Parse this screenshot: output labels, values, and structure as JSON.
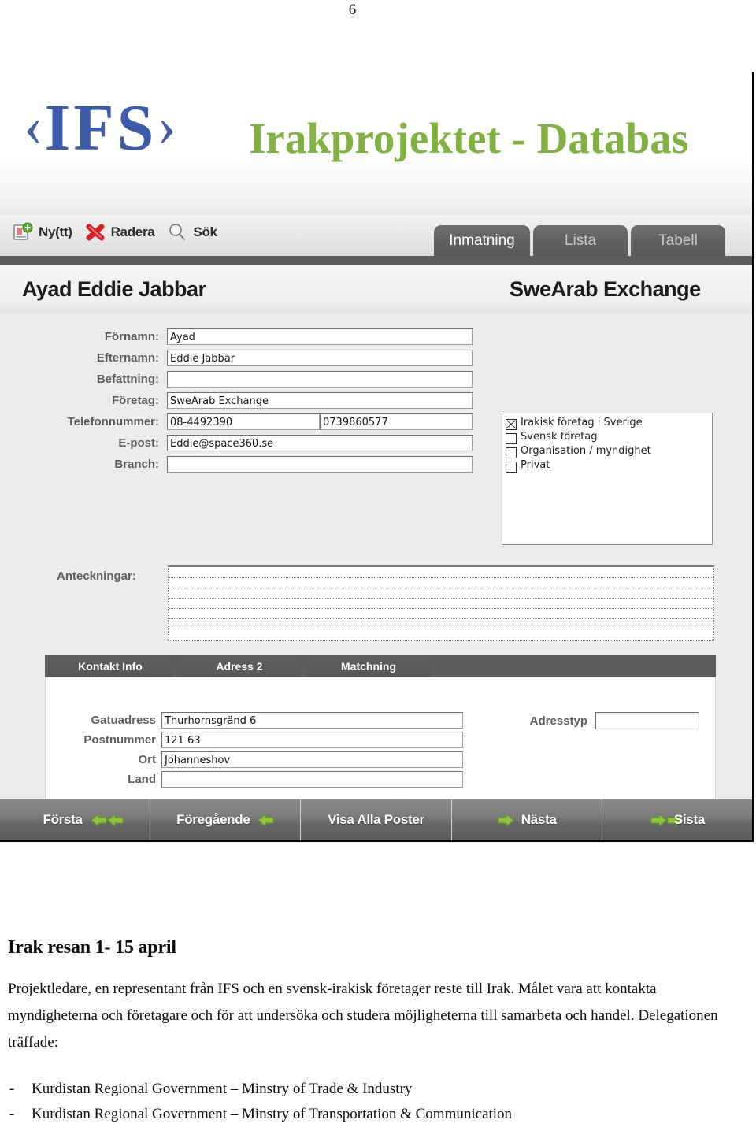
{
  "page_number": "6",
  "app": {
    "logo_left_bracket": "‹",
    "logo_text": "IFS",
    "logo_right_bracket": "›",
    "banner_title": "Irakprojektet - Databas",
    "brand_blue": "#3d5bab",
    "brand_green": "#7fb23e",
    "toolbar": {
      "buttons": [
        {
          "icon": "new-record-icon",
          "label": "Ny(tt)"
        },
        {
          "icon": "delete-x-icon",
          "label": "Radera"
        },
        {
          "icon": "search-magnifier-icon",
          "label": "Sök"
        }
      ]
    },
    "main_tabs": [
      {
        "label": "Inmatning",
        "active": true
      },
      {
        "label": "Lista",
        "active": false
      },
      {
        "label": "Tabell",
        "active": false
      }
    ],
    "record_header": {
      "name": "Ayad  Eddie Jabbar",
      "company": "SweArab Exchange"
    },
    "fields": [
      {
        "label": "Förnamn:",
        "value": "Ayad"
      },
      {
        "label": "Efternamn:",
        "value": "Eddie Jabbar"
      },
      {
        "label": "Befattning:",
        "value": ""
      },
      {
        "label": "Företag:",
        "value": "SweArab Exchange"
      },
      {
        "label": "Telefonnummer:",
        "value": "08-4492390",
        "value2": "0739860577"
      },
      {
        "label": "E-post:",
        "value": "Eddie@space360.se"
      },
      {
        "label": "Branch:",
        "value": ""
      }
    ],
    "category_checkboxes": [
      {
        "label": "Irakisk företag i Sverige",
        "checked": true
      },
      {
        "label": "Svensk företag",
        "checked": false
      },
      {
        "label": "Organisation / myndighet",
        "checked": false
      },
      {
        "label": "Privat",
        "checked": false
      }
    ],
    "notes": {
      "label": "Anteckningar:",
      "value": ""
    },
    "sub_tabs": [
      {
        "label": "Kontakt Info",
        "active": true
      },
      {
        "label": "Adress 2",
        "active": false
      },
      {
        "label": "Matchning",
        "active": false
      }
    ],
    "address_fields": [
      {
        "label": "Gatuadress",
        "value": "Thurhornsgränd 6"
      },
      {
        "label": "Postnummer",
        "value": "121 63"
      },
      {
        "label": "Ort",
        "value": "Johanneshov"
      },
      {
        "label": "Land",
        "value": ""
      }
    ],
    "address_type": {
      "label": "Adresstyp",
      "value": ""
    },
    "nav_buttons": [
      {
        "label": "Första",
        "arrows": "double-left",
        "arrow_position": "after"
      },
      {
        "label": "Föregående",
        "arrows": "single-left",
        "arrow_position": "after"
      },
      {
        "label": "Visa Alla Poster",
        "arrows": "none",
        "arrow_position": "none"
      },
      {
        "label": "Nästa",
        "arrows": "single-right",
        "arrow_position": "before"
      },
      {
        "label": "Sista",
        "arrows": "double-right",
        "arrow_position": "before"
      }
    ]
  },
  "document": {
    "heading": "Irak resan 1- 15 april",
    "paragraph": "Projektledare, en representant från IFS och en svensk-irakisk företager reste till Irak. Målet vara att kontakta myndigheterna och företagare och för att undersöka och studera möjligheterna till samarbeta och handel. Delegationen träffade:",
    "bullets": [
      "Kurdistan Regional  Government – Minstry of Trade & Industry",
      "Kurdistan Regional  Government – Minstry of Transportation & Communication"
    ],
    "bullet_marker": "-"
  }
}
